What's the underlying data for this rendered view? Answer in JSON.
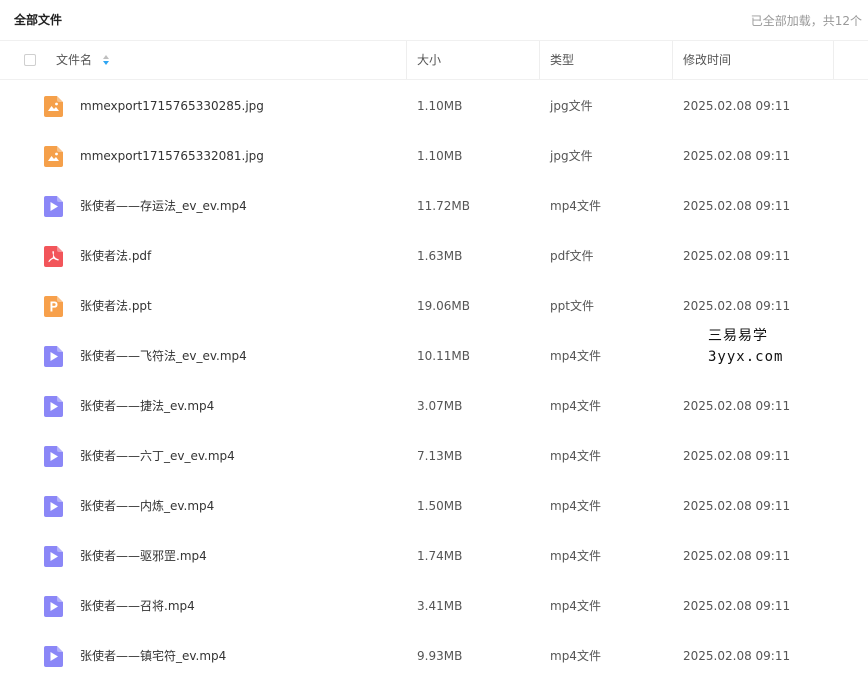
{
  "page": {
    "title": "全部文件",
    "load_status": "已全部加载，共12个"
  },
  "columns": {
    "name": "文件名",
    "size": "大小",
    "type": "类型",
    "modified": "修改时间"
  },
  "colors": {
    "image": "#f5a04a",
    "video": "#8b87f7",
    "pdf": "#f2555a",
    "ppt": "#f7a04b",
    "sort_up": "#bfbfbf",
    "sort_down": "#2ea5f2"
  },
  "files": [
    {
      "name": "mmexport1715765330285.jpg",
      "size": "1.10MB",
      "type": "jpg文件",
      "modified": "2025.02.08 09:11",
      "icon": "image-file-icon"
    },
    {
      "name": "mmexport1715765332081.jpg",
      "size": "1.10MB",
      "type": "jpg文件",
      "modified": "2025.02.08 09:11",
      "icon": "image-file-icon"
    },
    {
      "name": "张使者——存运法_ev_ev.mp4",
      "size": "11.72MB",
      "type": "mp4文件",
      "modified": "2025.02.08 09:11",
      "icon": "video-file-icon"
    },
    {
      "name": "张使者法.pdf",
      "size": "1.63MB",
      "type": "pdf文件",
      "modified": "2025.02.08 09:11",
      "icon": "pdf-file-icon"
    },
    {
      "name": "张使者法.ppt",
      "size": "19.06MB",
      "type": "ppt文件",
      "modified": "2025.02.08 09:11",
      "icon": "ppt-file-icon"
    },
    {
      "name": "张使者——飞符法_ev_ev.mp4",
      "size": "10.11MB",
      "type": "mp4文件",
      "modified": "",
      "icon": "video-file-icon"
    },
    {
      "name": "张使者——捷法_ev.mp4",
      "size": "3.07MB",
      "type": "mp4文件",
      "modified": "2025.02.08 09:11",
      "icon": "video-file-icon"
    },
    {
      "name": "张使者——六丁_ev_ev.mp4",
      "size": "7.13MB",
      "type": "mp4文件",
      "modified": "2025.02.08 09:11",
      "icon": "video-file-icon"
    },
    {
      "name": "张使者——内炼_ev.mp4",
      "size": "1.50MB",
      "type": "mp4文件",
      "modified": "2025.02.08 09:11",
      "icon": "video-file-icon"
    },
    {
      "name": "张使者——驱邪罡.mp4",
      "size": "1.74MB",
      "type": "mp4文件",
      "modified": "2025.02.08 09:11",
      "icon": "video-file-icon"
    },
    {
      "name": "张使者——召将.mp4",
      "size": "3.41MB",
      "type": "mp4文件",
      "modified": "2025.02.08 09:11",
      "icon": "video-file-icon"
    },
    {
      "name": "张使者——镇宅符_ev.mp4",
      "size": "9.93MB",
      "type": "mp4文件",
      "modified": "2025.02.08 09:11",
      "icon": "video-file-icon"
    }
  ],
  "watermark": {
    "line1": "三易易学",
    "line2": "3yyx.com"
  }
}
